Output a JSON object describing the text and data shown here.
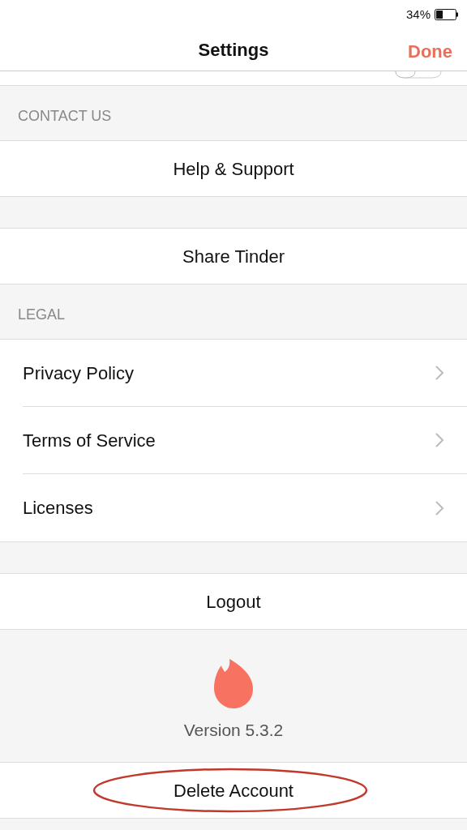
{
  "status_bar": {
    "battery": "34%"
  },
  "navbar": {
    "title": "Settings",
    "done": "Done"
  },
  "sections": [
    {
      "kind": "toggle_edge",
      "on": false
    },
    {
      "kind": "header",
      "label": "CONTACT US"
    },
    {
      "kind": "action",
      "label": "Help & Support",
      "circled": false
    },
    {
      "kind": "gap"
    },
    {
      "kind": "action",
      "label": "Share Tinder",
      "circled": false
    },
    {
      "kind": "header",
      "label": "LEGAL"
    },
    {
      "kind": "links",
      "items": [
        "Privacy Policy",
        "Terms of Service",
        "Licenses"
      ]
    },
    {
      "kind": "gap"
    },
    {
      "kind": "action",
      "label": "Logout",
      "circled": false
    },
    {
      "kind": "footer",
      "version": "Version 5.3.2"
    },
    {
      "kind": "action",
      "label": "Delete Account",
      "circled": true
    }
  ]
}
